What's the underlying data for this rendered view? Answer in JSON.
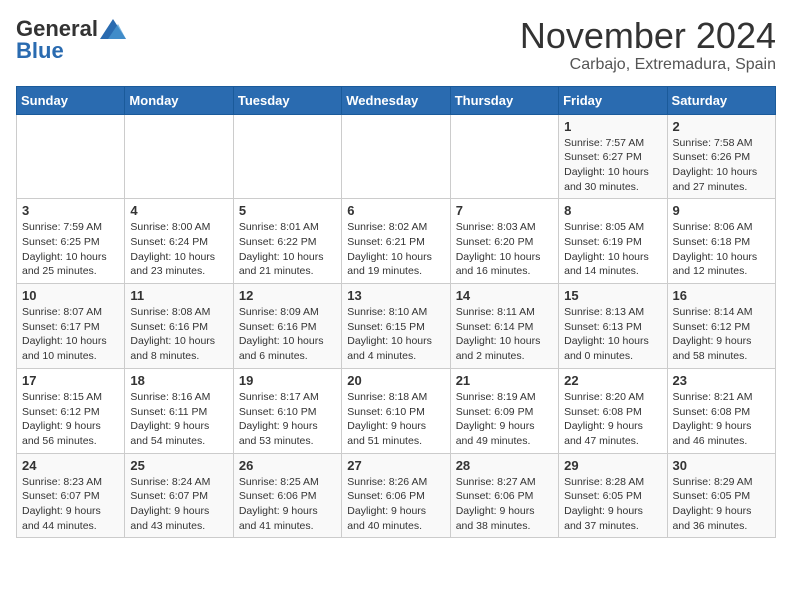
{
  "header": {
    "logo_general": "General",
    "logo_blue": "Blue",
    "month": "November 2024",
    "location": "Carbajo, Extremadura, Spain"
  },
  "weekdays": [
    "Sunday",
    "Monday",
    "Tuesday",
    "Wednesday",
    "Thursday",
    "Friday",
    "Saturday"
  ],
  "weeks": [
    [
      {
        "day": null,
        "info": null
      },
      {
        "day": null,
        "info": null
      },
      {
        "day": null,
        "info": null
      },
      {
        "day": null,
        "info": null
      },
      {
        "day": null,
        "info": null
      },
      {
        "day": "1",
        "info": "Sunrise: 7:57 AM\nSunset: 6:27 PM\nDaylight: 10 hours and 30 minutes."
      },
      {
        "day": "2",
        "info": "Sunrise: 7:58 AM\nSunset: 6:26 PM\nDaylight: 10 hours and 27 minutes."
      }
    ],
    [
      {
        "day": "3",
        "info": "Sunrise: 7:59 AM\nSunset: 6:25 PM\nDaylight: 10 hours and 25 minutes."
      },
      {
        "day": "4",
        "info": "Sunrise: 8:00 AM\nSunset: 6:24 PM\nDaylight: 10 hours and 23 minutes."
      },
      {
        "day": "5",
        "info": "Sunrise: 8:01 AM\nSunset: 6:22 PM\nDaylight: 10 hours and 21 minutes."
      },
      {
        "day": "6",
        "info": "Sunrise: 8:02 AM\nSunset: 6:21 PM\nDaylight: 10 hours and 19 minutes."
      },
      {
        "day": "7",
        "info": "Sunrise: 8:03 AM\nSunset: 6:20 PM\nDaylight: 10 hours and 16 minutes."
      },
      {
        "day": "8",
        "info": "Sunrise: 8:05 AM\nSunset: 6:19 PM\nDaylight: 10 hours and 14 minutes."
      },
      {
        "day": "9",
        "info": "Sunrise: 8:06 AM\nSunset: 6:18 PM\nDaylight: 10 hours and 12 minutes."
      }
    ],
    [
      {
        "day": "10",
        "info": "Sunrise: 8:07 AM\nSunset: 6:17 PM\nDaylight: 10 hours and 10 minutes."
      },
      {
        "day": "11",
        "info": "Sunrise: 8:08 AM\nSunset: 6:16 PM\nDaylight: 10 hours and 8 minutes."
      },
      {
        "day": "12",
        "info": "Sunrise: 8:09 AM\nSunset: 6:16 PM\nDaylight: 10 hours and 6 minutes."
      },
      {
        "day": "13",
        "info": "Sunrise: 8:10 AM\nSunset: 6:15 PM\nDaylight: 10 hours and 4 minutes."
      },
      {
        "day": "14",
        "info": "Sunrise: 8:11 AM\nSunset: 6:14 PM\nDaylight: 10 hours and 2 minutes."
      },
      {
        "day": "15",
        "info": "Sunrise: 8:13 AM\nSunset: 6:13 PM\nDaylight: 10 hours and 0 minutes."
      },
      {
        "day": "16",
        "info": "Sunrise: 8:14 AM\nSunset: 6:12 PM\nDaylight: 9 hours and 58 minutes."
      }
    ],
    [
      {
        "day": "17",
        "info": "Sunrise: 8:15 AM\nSunset: 6:12 PM\nDaylight: 9 hours and 56 minutes."
      },
      {
        "day": "18",
        "info": "Sunrise: 8:16 AM\nSunset: 6:11 PM\nDaylight: 9 hours and 54 minutes."
      },
      {
        "day": "19",
        "info": "Sunrise: 8:17 AM\nSunset: 6:10 PM\nDaylight: 9 hours and 53 minutes."
      },
      {
        "day": "20",
        "info": "Sunrise: 8:18 AM\nSunset: 6:10 PM\nDaylight: 9 hours and 51 minutes."
      },
      {
        "day": "21",
        "info": "Sunrise: 8:19 AM\nSunset: 6:09 PM\nDaylight: 9 hours and 49 minutes."
      },
      {
        "day": "22",
        "info": "Sunrise: 8:20 AM\nSunset: 6:08 PM\nDaylight: 9 hours and 47 minutes."
      },
      {
        "day": "23",
        "info": "Sunrise: 8:21 AM\nSunset: 6:08 PM\nDaylight: 9 hours and 46 minutes."
      }
    ],
    [
      {
        "day": "24",
        "info": "Sunrise: 8:23 AM\nSunset: 6:07 PM\nDaylight: 9 hours and 44 minutes."
      },
      {
        "day": "25",
        "info": "Sunrise: 8:24 AM\nSunset: 6:07 PM\nDaylight: 9 hours and 43 minutes."
      },
      {
        "day": "26",
        "info": "Sunrise: 8:25 AM\nSunset: 6:06 PM\nDaylight: 9 hours and 41 minutes."
      },
      {
        "day": "27",
        "info": "Sunrise: 8:26 AM\nSunset: 6:06 PM\nDaylight: 9 hours and 40 minutes."
      },
      {
        "day": "28",
        "info": "Sunrise: 8:27 AM\nSunset: 6:06 PM\nDaylight: 9 hours and 38 minutes."
      },
      {
        "day": "29",
        "info": "Sunrise: 8:28 AM\nSunset: 6:05 PM\nDaylight: 9 hours and 37 minutes."
      },
      {
        "day": "30",
        "info": "Sunrise: 8:29 AM\nSunset: 6:05 PM\nDaylight: 9 hours and 36 minutes."
      }
    ]
  ]
}
